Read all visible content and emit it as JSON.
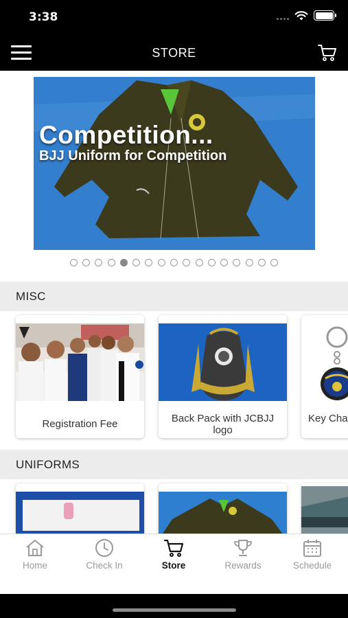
{
  "status_bar": {
    "time": "3:38"
  },
  "nav": {
    "title": "STORE"
  },
  "banner": {
    "title": "Competition...",
    "subtitle": "BJJ Uniform for Competition",
    "dot_count": 17,
    "active_dot": 5
  },
  "sections": [
    {
      "title": "MISC",
      "items": [
        {
          "label": "Registration Fee"
        },
        {
          "label": "Back Pack with JCBJJ logo"
        },
        {
          "label": "Key Cha"
        }
      ]
    },
    {
      "title": "UNIFORMS",
      "items": []
    }
  ],
  "tabs": [
    {
      "label": "Home",
      "icon": "home-icon"
    },
    {
      "label": "Check In",
      "icon": "clock-icon"
    },
    {
      "label": "Store",
      "icon": "cart-icon",
      "active": true
    },
    {
      "label": "Rewards",
      "icon": "trophy-icon"
    },
    {
      "label": "Schedule",
      "icon": "calendar-icon"
    }
  ]
}
